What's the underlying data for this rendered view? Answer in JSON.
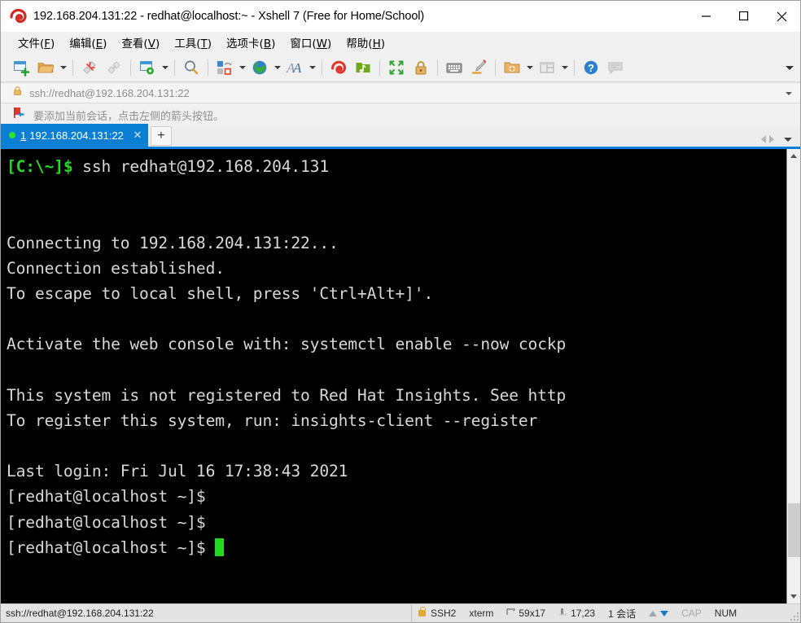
{
  "window": {
    "title": "192.168.204.131:22 - redhat@localhost:~ - Xshell 7 (Free for Home/School)",
    "icon": "xshell-logo-icon",
    "buttons": {
      "minimize": "–",
      "maximize": "□",
      "close": "✕"
    }
  },
  "menubar": [
    {
      "name": "file",
      "pre": "文件(",
      "mn": "F",
      "post": ")"
    },
    {
      "name": "edit",
      "pre": "编辑(",
      "mn": "E",
      "post": ")"
    },
    {
      "name": "view",
      "pre": "查看(",
      "mn": "V",
      "post": ")"
    },
    {
      "name": "tools",
      "pre": "工具(",
      "mn": "T",
      "post": ")"
    },
    {
      "name": "tabs",
      "pre": "选项卡(",
      "mn": "B",
      "post": ")"
    },
    {
      "name": "window",
      "pre": "窗口(",
      "mn": "W",
      "post": ")"
    },
    {
      "name": "help",
      "pre": "帮助(",
      "mn": "H",
      "post": ")"
    }
  ],
  "toolbar": {
    "items": [
      {
        "icon": "new-session-icon",
        "caret": false
      },
      {
        "icon": "open-folder-icon",
        "caret": true
      },
      {
        "sep": true
      },
      {
        "icon": "disconnect-icon",
        "caret": false,
        "disabled": true
      },
      {
        "icon": "reconnect-icon",
        "caret": false,
        "disabled": true
      },
      {
        "sep": true
      },
      {
        "icon": "session-properties-icon",
        "caret": true
      },
      {
        "sep": true
      },
      {
        "icon": "find-search-icon",
        "caret": false
      },
      {
        "sep": true
      },
      {
        "icon": "file-transfer-icon",
        "caret": true
      },
      {
        "icon": "globe-encoding-icon",
        "caret": true
      },
      {
        "icon": "font-style-icon",
        "caret": true
      },
      {
        "sep": true
      },
      {
        "icon": "xshell-red-icon",
        "caret": false
      },
      {
        "icon": "xftp-green-icon",
        "caret": false
      },
      {
        "sep": true
      },
      {
        "icon": "fullscreen-icon",
        "caret": false
      },
      {
        "icon": "lock-icon",
        "caret": false
      },
      {
        "sep": true
      },
      {
        "icon": "keyboard-icon",
        "caret": false
      },
      {
        "icon": "highlighter-icon",
        "caret": false
      },
      {
        "sep": true
      },
      {
        "icon": "add-to-folder-icon",
        "caret": true
      },
      {
        "icon": "layout-panes-icon",
        "caret": true,
        "disabled": true
      },
      {
        "sep": true
      },
      {
        "icon": "help-question-icon",
        "caret": false
      },
      {
        "icon": "chat-bubble-icon",
        "caret": false,
        "disabled": true
      }
    ],
    "overflow_icon": "toolbar-overflow-chevron-icon"
  },
  "address_bar": {
    "icon": "lock-icon",
    "value": "ssh://redhat@192.168.204.131:22",
    "placeholder": "ssh://redhat@192.168.204.131:22",
    "dropdown_icon": "chevron-down-icon"
  },
  "notice_bar": {
    "icon": "red-flag-arrow-icon",
    "text": "要添加当前会话，点击左侧的箭头按钮。"
  },
  "tabbar": {
    "tabs": [
      {
        "number": "1",
        "label": "192.168.204.131:22",
        "active": true,
        "status": "connected",
        "close_icon": "close-icon"
      }
    ],
    "new_tab_label": "+",
    "nav_prev_icon": "triangle-left-icon",
    "nav_next_icon": "triangle-right-icon",
    "nav_list_icon": "chevron-down-icon",
    "active_color": "#0a7fd4"
  },
  "terminal": {
    "background": "#000000",
    "foreground": "#d8d8d8",
    "prompt_color": "#23d723",
    "cursor_color": "#23d723",
    "lines": [
      {
        "segments": [
          {
            "text": "[C:\\~]$ ",
            "color": "green"
          },
          {
            "text": "ssh redhat@192.168.204.131",
            "color": "normal"
          }
        ]
      },
      {
        "segments": [
          {
            "text": "",
            "color": "normal"
          }
        ]
      },
      {
        "segments": [
          {
            "text": "",
            "color": "normal"
          }
        ]
      },
      {
        "segments": [
          {
            "text": "Connecting to 192.168.204.131:22...",
            "color": "normal"
          }
        ]
      },
      {
        "segments": [
          {
            "text": "Connection established.",
            "color": "normal"
          }
        ]
      },
      {
        "segments": [
          {
            "text": "To escape to local shell, press 'Ctrl+Alt+]'.",
            "color": "normal"
          }
        ]
      },
      {
        "segments": [
          {
            "text": "",
            "color": "normal"
          }
        ]
      },
      {
        "segments": [
          {
            "text": "Activate the web console with: systemctl enable --now cockp",
            "color": "normal"
          }
        ]
      },
      {
        "segments": [
          {
            "text": "",
            "color": "normal"
          }
        ]
      },
      {
        "segments": [
          {
            "text": "This system is not registered to Red Hat Insights. See http",
            "color": "normal"
          }
        ]
      },
      {
        "segments": [
          {
            "text": "To register this system, run: insights-client --register",
            "color": "normal"
          }
        ]
      },
      {
        "segments": [
          {
            "text": "",
            "color": "normal"
          }
        ]
      },
      {
        "segments": [
          {
            "text": "Last login: Fri Jul 16 17:38:43 2021",
            "color": "normal"
          }
        ]
      },
      {
        "segments": [
          {
            "text": "[redhat@localhost ~]$",
            "color": "normal"
          }
        ]
      },
      {
        "segments": [
          {
            "text": "[redhat@localhost ~]$",
            "color": "normal"
          }
        ]
      },
      {
        "segments": [
          {
            "text": "[redhat@localhost ~]$ ",
            "color": "normal"
          },
          {
            "cursor": true
          }
        ]
      }
    ],
    "scrollbar": {
      "up_icon": "chevron-up-icon",
      "down_icon": "chevron-down-icon"
    }
  },
  "statusbar": {
    "path": "ssh://redhat@192.168.204.131:22",
    "protocol_icon": "lock-icon",
    "protocol": "SSH2",
    "term_type": "xterm",
    "size_icon": "terminal-size-icon",
    "size": "59x17",
    "cursor_icon": "cursor-position-icon",
    "cursor_pos": "17,23",
    "sessions": "1 会话",
    "upload_icon": "arrow-up-icon",
    "download_icon": "arrow-down-icon",
    "caps": "CAP",
    "num": "NUM",
    "grip_icon": "resize-grip-icon"
  }
}
